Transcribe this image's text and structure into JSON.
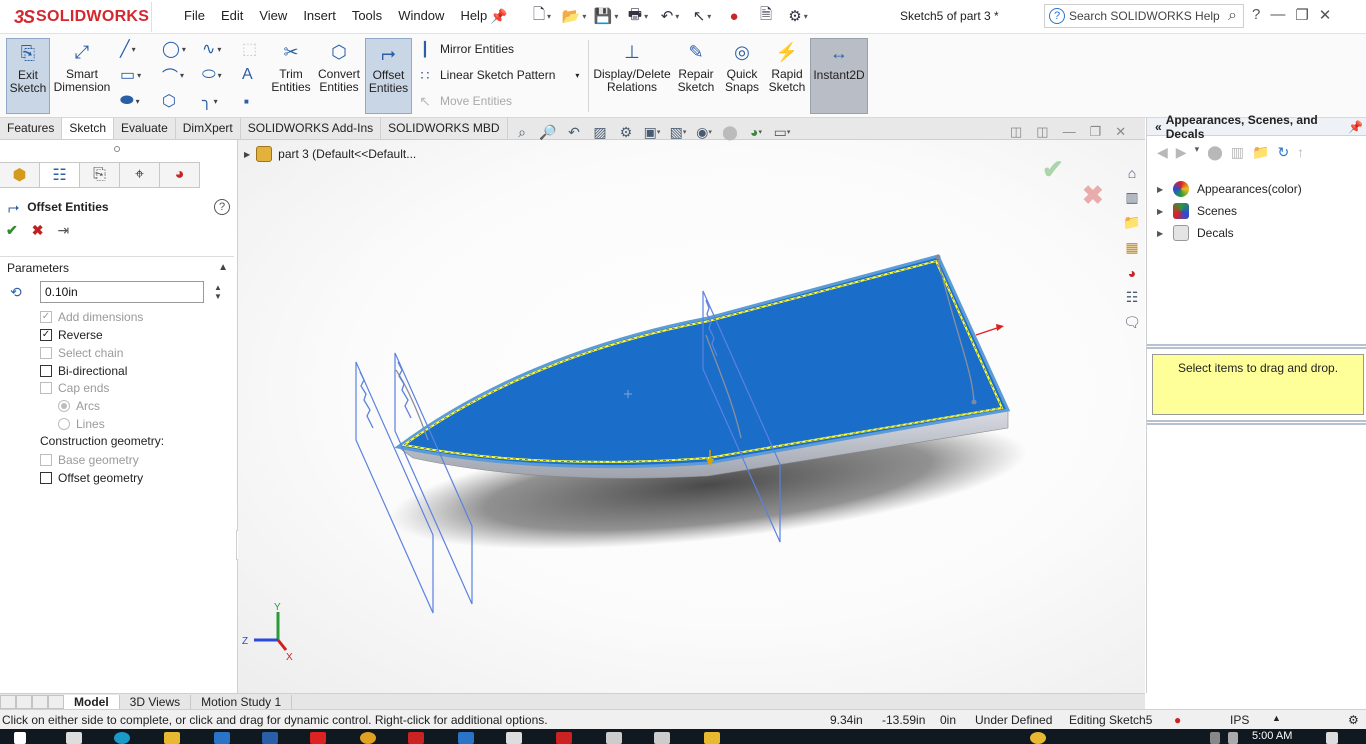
{
  "app": {
    "brand_prefix": "3S",
    "brand_name": "SOLIDWORKS",
    "menu": [
      "File",
      "Edit",
      "View",
      "Insert",
      "Tools",
      "Window",
      "Help"
    ],
    "document_title": "Sketch5 of part 3 *",
    "search_placeholder": "Search SOLIDWORKS Help",
    "help_label": "?"
  },
  "ribbon": {
    "exit_sketch": "Exit Sketch",
    "smart_dimension": "Smart Dimension",
    "trim_entities": "Trim Entities",
    "convert_entities": "Convert Entities",
    "offset_entities": "Offset Entities",
    "mirror_entities": "Mirror Entities",
    "linear_sketch_pattern": "Linear Sketch Pattern",
    "move_entities": "Move Entities",
    "display_delete_relations": "Display/Delete Relations",
    "repair_sketch": "Repair Sketch",
    "quick_snaps": "Quick Snaps",
    "rapid_sketch": "Rapid Sketch",
    "instant2d": "Instant2D"
  },
  "command_tabs": [
    {
      "label": "Features",
      "selected": false
    },
    {
      "label": "Sketch",
      "selected": true
    },
    {
      "label": "Evaluate",
      "selected": false
    },
    {
      "label": "DimXpert",
      "selected": false
    },
    {
      "label": "SOLIDWORKS Add-Ins",
      "selected": false
    },
    {
      "label": "SOLIDWORKS MBD",
      "selected": false
    }
  ],
  "property_manager": {
    "title": "Offset Entities",
    "section": "Parameters",
    "distance_value": "0.10in",
    "options": [
      {
        "label": "Add dimensions",
        "checked": true,
        "disabled": true
      },
      {
        "label": "Reverse",
        "checked": true,
        "disabled": false
      },
      {
        "label": "Select chain",
        "checked": false,
        "disabled": true
      },
      {
        "label": "Bi-directional",
        "checked": false,
        "disabled": false
      },
      {
        "label": "Cap ends",
        "checked": false,
        "disabled": true
      }
    ],
    "cap_radios": [
      {
        "label": "Arcs",
        "selected": true
      },
      {
        "label": "Lines",
        "selected": false
      }
    ],
    "construction_label": "Construction geometry:",
    "construction_options": [
      {
        "label": "Base geometry",
        "checked": false,
        "disabled": true
      },
      {
        "label": "Offset geometry",
        "checked": false,
        "disabled": false
      }
    ]
  },
  "graphics": {
    "tree_label": "part 3  (Default<<Default...",
    "triad": {
      "y": "Y",
      "z": "Z",
      "x": "X"
    },
    "colors": {
      "face": "#1a6ec9",
      "edge_highlight": "#ffff33",
      "plane": "#5a82e0",
      "hull_side": "#c8ccd6"
    }
  },
  "task_pane": {
    "title": "Appearances, Scenes, and Decals",
    "items": [
      {
        "label": "Appearances(color)",
        "icon": "appearance-ball-icon"
      },
      {
        "label": "Scenes",
        "icon": "scene-icon"
      },
      {
        "label": "Decals",
        "icon": "decal-icon"
      }
    ],
    "drop_hint": "Select items to drag and drop."
  },
  "bottom_tabs": [
    {
      "label": "Model",
      "selected": true
    },
    {
      "label": "3D Views",
      "selected": false
    },
    {
      "label": "Motion Study 1",
      "selected": false
    }
  ],
  "status_bar": {
    "message": "Click on either side to complete, or click and drag for dynamic control.  Right-click for additional options.",
    "x": "9.34in",
    "y": "-13.59in",
    "z": "0in",
    "state": "Under Defined",
    "editing": "Editing Sketch5",
    "units": "IPS"
  },
  "taskbar": {
    "clock": "5:00 AM"
  }
}
